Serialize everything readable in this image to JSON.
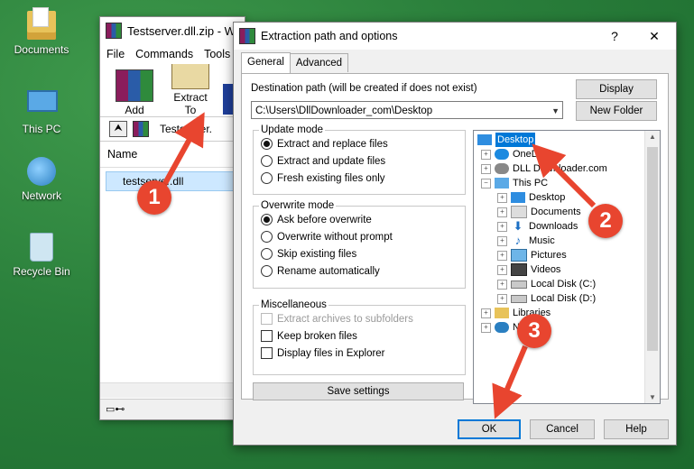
{
  "desktop": {
    "icons": [
      {
        "label": "Documents",
        "icon": "documents-folder-icon"
      },
      {
        "label": "This PC",
        "icon": "computer-icon"
      },
      {
        "label": "Network",
        "icon": "network-globe-icon"
      },
      {
        "label": "Recycle Bin",
        "icon": "recycle-bin-icon"
      }
    ]
  },
  "winrar": {
    "title": "Testserver.dll.zip - W",
    "menu": [
      "File",
      "Commands",
      "Tools"
    ],
    "toolbar": {
      "add": "Add",
      "extract_to": "Extract To"
    },
    "path": "Testserver.",
    "list_header": "Name",
    "file": "testserver.dll"
  },
  "dialog": {
    "title": "Extraction path and options",
    "help_glyph": "?",
    "close_glyph": "✕",
    "tabs": [
      "General",
      "Advanced"
    ],
    "destination_label": "Destination path (will be created if does not exist)",
    "destination_value": "C:\\Users\\DllDownloader_com\\Desktop",
    "display_button": "Display",
    "new_folder_button": "New Folder",
    "update_mode": {
      "legend": "Update mode",
      "options": [
        "Extract and replace files",
        "Extract and update files",
        "Fresh existing files only"
      ],
      "selected": 0
    },
    "overwrite_mode": {
      "legend": "Overwrite mode",
      "options": [
        "Ask before overwrite",
        "Overwrite without prompt",
        "Skip existing files",
        "Rename automatically"
      ],
      "selected": 0
    },
    "miscellaneous": {
      "legend": "Miscellaneous",
      "options": [
        {
          "label": "Extract archives to subfolders",
          "disabled": true
        },
        {
          "label": "Keep broken files",
          "disabled": false
        },
        {
          "label": "Display files in Explorer",
          "disabled": false
        }
      ]
    },
    "save_settings": "Save settings",
    "tree": [
      {
        "label": "Desktop",
        "selected": true
      },
      {
        "label": "OneDrive"
      },
      {
        "label": "DLL Downloader.com"
      },
      {
        "label": "This PC"
      },
      {
        "label": "Desktop"
      },
      {
        "label": "Documents"
      },
      {
        "label": "Downloads"
      },
      {
        "label": "Music"
      },
      {
        "label": "Pictures"
      },
      {
        "label": "Videos"
      },
      {
        "label": "Local Disk (C:)"
      },
      {
        "label": "Local Disk (D:)"
      },
      {
        "label": "Libraries"
      },
      {
        "label": "N"
      }
    ],
    "ok": "OK",
    "cancel": "Cancel",
    "help": "Help"
  },
  "annotations": [
    "1",
    "2",
    "3"
  ],
  "colors": {
    "accent": "#0078d7",
    "annotation": "#e8452f",
    "desktop": "#2a7f3b"
  }
}
